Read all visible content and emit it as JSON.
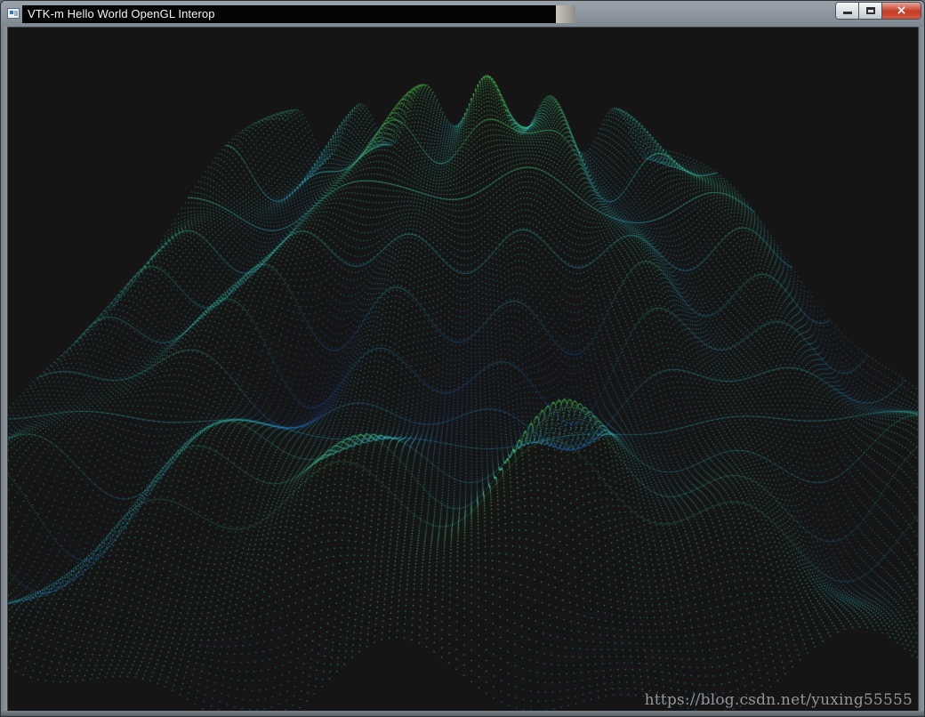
{
  "window": {
    "title": "VTK-m Hello World OpenGL Interop",
    "app_icon": "application-icon",
    "controls": {
      "minimize": "minimize-icon",
      "maximize": "maximize-icon",
      "close": "close-icon"
    }
  },
  "viewport": {
    "background_color": "#151515",
    "point_color_low": "#1f5fd8",
    "point_color_mid": "#36c6c9",
    "point_color_high": "#4fcf5a",
    "render_type": "point-cloud-surface"
  },
  "watermark": {
    "text": "https://blog.csdn.net/yuxing55555"
  }
}
